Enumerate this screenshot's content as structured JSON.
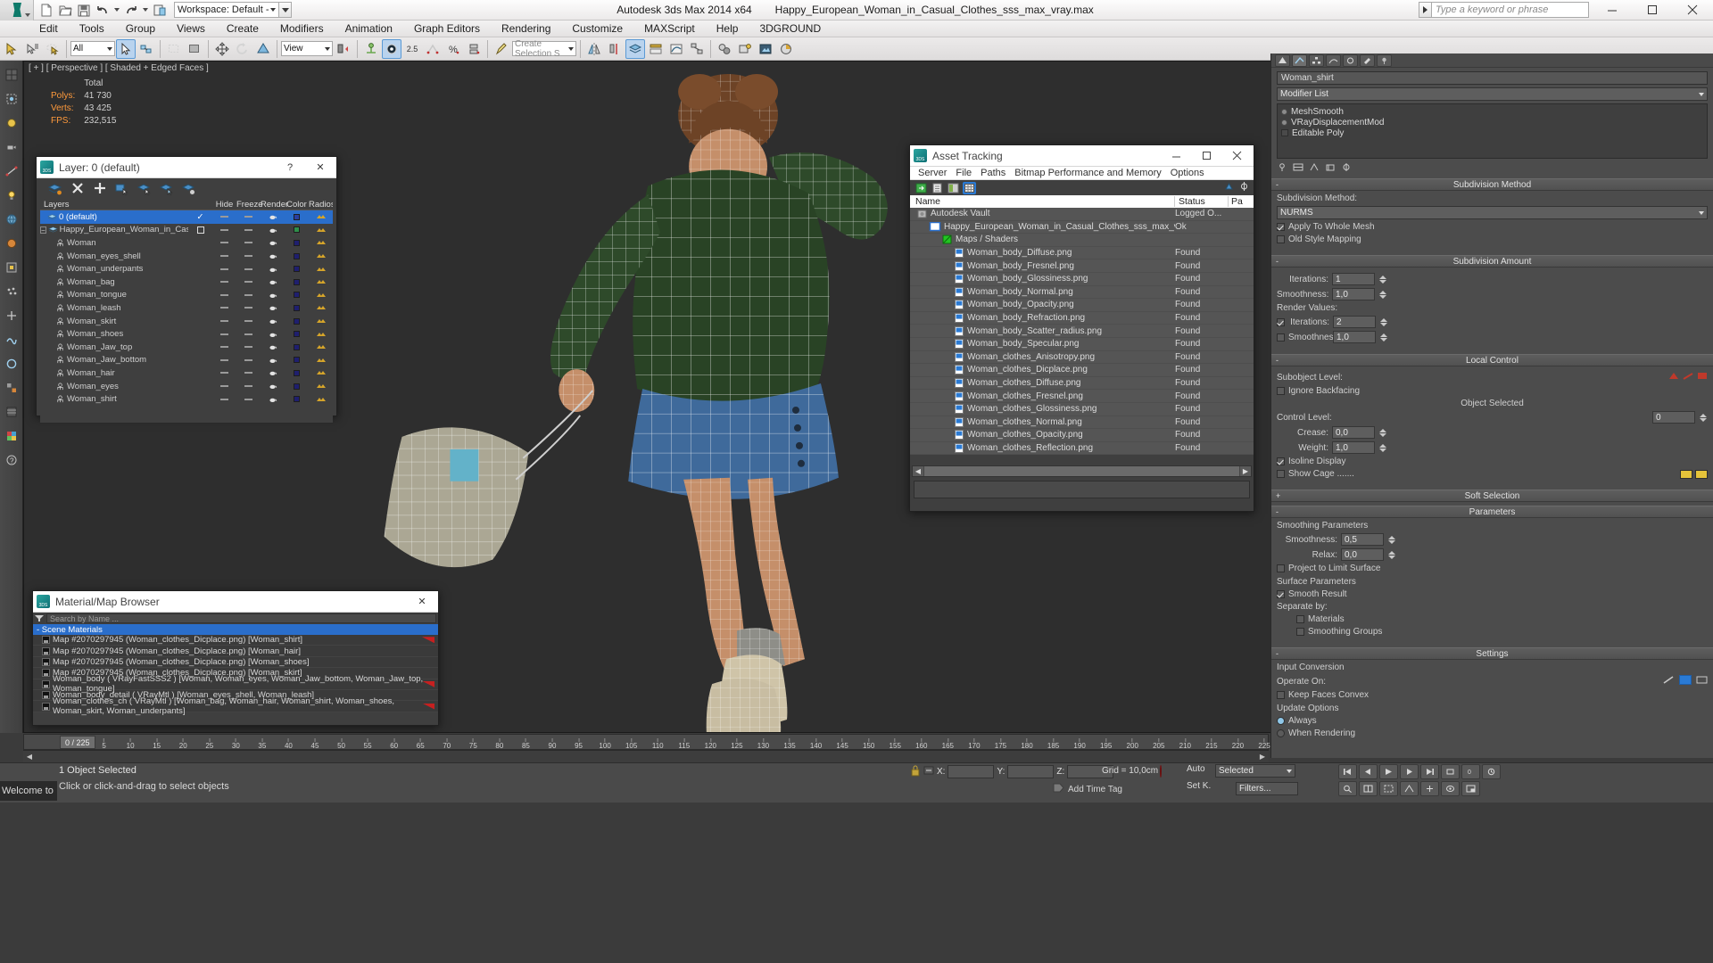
{
  "titlebar": {
    "workspace_label": "Workspace: Default - ",
    "app_title": "Autodesk 3ds Max  2014 x64",
    "file_title": "Happy_European_Woman_in_Casual_Clothes_sss_max_vray.max",
    "search_placeholder": "Type a keyword or phrase",
    "minimize": "–",
    "maximize": "☐",
    "close": "✕"
  },
  "menubar": {
    "items": [
      "Edit",
      "Tools",
      "Group",
      "Views",
      "Create",
      "Modifiers",
      "Animation",
      "Graph Editors",
      "Rendering",
      "Customize",
      "MAXScript",
      "Help",
      "3DGROUND"
    ]
  },
  "toolbar": {
    "filter_combo": "All",
    "ref_coord_combo": "View",
    "named_selection_placeholder": "Create Selection S",
    "percent_snap": "2.5"
  },
  "viewport": {
    "label": "[ + ] [ Perspective ] [ Shaded + Edged Faces ]",
    "stats": {
      "header": "Total",
      "rows": [
        {
          "label": "Polys:",
          "value": "41 730"
        },
        {
          "label": "Verts:",
          "value": "43 425"
        },
        {
          "label": "FPS:",
          "value": "232,515"
        }
      ]
    }
  },
  "layer_window": {
    "title": "Layer: 0 (default)",
    "help_btn": "?",
    "close_btn": "✕",
    "columns": [
      "Layers",
      "Hide",
      "Freeze",
      "Render",
      "Color",
      "Radiosity"
    ],
    "rows": [
      {
        "name": "0 (default)",
        "indent": 1,
        "selected": true,
        "active": true,
        "type": "layer"
      },
      {
        "name": "Happy_European_Woman_in_Casual_Clothes_sss",
        "indent": 0,
        "selected": false,
        "active": false,
        "type": "layer",
        "expander": "−"
      },
      {
        "name": "Woman",
        "indent": 2,
        "type": "object"
      },
      {
        "name": "Woman_eyes_shell",
        "indent": 2,
        "type": "object"
      },
      {
        "name": "Woman_underpants",
        "indent": 2,
        "type": "object"
      },
      {
        "name": "Woman_bag",
        "indent": 2,
        "type": "object"
      },
      {
        "name": "Woman_tongue",
        "indent": 2,
        "type": "object"
      },
      {
        "name": "Woman_leash",
        "indent": 2,
        "type": "object"
      },
      {
        "name": "Woman_skirt",
        "indent": 2,
        "type": "object"
      },
      {
        "name": "Woman_shoes",
        "indent": 2,
        "type": "object"
      },
      {
        "name": "Woman_Jaw_top",
        "indent": 2,
        "type": "object"
      },
      {
        "name": "Woman_Jaw_bottom",
        "indent": 2,
        "type": "object"
      },
      {
        "name": "Woman_hair",
        "indent": 2,
        "type": "object"
      },
      {
        "name": "Woman_eyes",
        "indent": 2,
        "type": "object"
      },
      {
        "name": "Woman_shirt",
        "indent": 2,
        "type": "object"
      }
    ]
  },
  "asset_window": {
    "title": "Asset Tracking",
    "minimize": "–",
    "maximize": "☐",
    "close": "✕",
    "menu": [
      "Server",
      "File",
      "Paths",
      "Bitmap Performance and Memory",
      "Options"
    ],
    "columns": {
      "name": "Name",
      "status": "Status",
      "path": "Pa"
    },
    "rows": [
      {
        "name": "Autodesk Vault",
        "status": "Logged O...",
        "indent": 0,
        "icon": "vault-icon"
      },
      {
        "name": "Happy_European_Woman_in_Casual_Clothes_sss_max_vray.max",
        "status": "Ok",
        "indent": 1,
        "icon": "scene-icon"
      },
      {
        "name": "Maps / Shaders",
        "status": "",
        "indent": 2,
        "icon": "maps-icon"
      },
      {
        "name": "Woman_body_Diffuse.png",
        "status": "Found",
        "indent": 3,
        "icon": "bitmap-icon"
      },
      {
        "name": "Woman_body_Fresnel.png",
        "status": "Found",
        "indent": 3,
        "icon": "bitmap-icon"
      },
      {
        "name": "Woman_body_Glossiness.png",
        "status": "Found",
        "indent": 3,
        "icon": "bitmap-icon"
      },
      {
        "name": "Woman_body_Normal.png",
        "status": "Found",
        "indent": 3,
        "icon": "bitmap-icon"
      },
      {
        "name": "Woman_body_Opacity.png",
        "status": "Found",
        "indent": 3,
        "icon": "bitmap-icon"
      },
      {
        "name": "Woman_body_Refraction.png",
        "status": "Found",
        "indent": 3,
        "icon": "bitmap-icon"
      },
      {
        "name": "Woman_body_Scatter_radius.png",
        "status": "Found",
        "indent": 3,
        "icon": "bitmap-icon"
      },
      {
        "name": "Woman_body_Specular.png",
        "status": "Found",
        "indent": 3,
        "icon": "bitmap-icon"
      },
      {
        "name": "Woman_clothes_Anisotropy.png",
        "status": "Found",
        "indent": 3,
        "icon": "bitmap-icon"
      },
      {
        "name": "Woman_clothes_Dicplace.png",
        "status": "Found",
        "indent": 3,
        "icon": "bitmap-icon"
      },
      {
        "name": "Woman_clothes_Diffuse.png",
        "status": "Found",
        "indent": 3,
        "icon": "bitmap-icon"
      },
      {
        "name": "Woman_clothes_Fresnel.png",
        "status": "Found",
        "indent": 3,
        "icon": "bitmap-icon"
      },
      {
        "name": "Woman_clothes_Glossiness.png",
        "status": "Found",
        "indent": 3,
        "icon": "bitmap-icon"
      },
      {
        "name": "Woman_clothes_Normal.png",
        "status": "Found",
        "indent": 3,
        "icon": "bitmap-icon"
      },
      {
        "name": "Woman_clothes_Opacity.png",
        "status": "Found",
        "indent": 3,
        "icon": "bitmap-icon"
      },
      {
        "name": "Woman_clothes_Reflection.png",
        "status": "Found",
        "indent": 3,
        "icon": "bitmap-icon"
      }
    ]
  },
  "material_window": {
    "title": "Material/Map Browser",
    "close_btn": "✕",
    "search_placeholder": "Search by Name ...",
    "group_header": "-  Scene Materials",
    "rows": [
      {
        "name": "Map #2070297945 (Woman_clothes_Dicplace.png)  [Woman_shirt]",
        "flag": true
      },
      {
        "name": "Map #2070297945 (Woman_clothes_Dicplace.png)  [Woman_hair]",
        "flag": false
      },
      {
        "name": "Map #2070297945 (Woman_clothes_Dicplace.png)  [Woman_shoes]",
        "flag": false
      },
      {
        "name": "Map #2070297945 (Woman_clothes_Dicplace.png)  [Woman_skirt]",
        "flag": false
      },
      {
        "name": "Woman_body  ( VRayFastSSS2 )  [Woman, Woman_eyes, Woman_Jaw_bottom, Woman_Jaw_top, Woman_tongue]",
        "flag": true
      },
      {
        "name": "Woman_body_detail  ( VRayMtl )  [Woman_eyes_shell, Woman_leash]",
        "flag": false
      },
      {
        "name": "Woman_clothes_ch  ( VRayMtl )  [Woman_bag, Woman_hair, Woman_shirt, Woman_shoes, Woman_skirt, Woman_underpants]",
        "flag": true
      }
    ]
  },
  "command_panel": {
    "object_name": "Woman_shirt",
    "modifier_list_label": "Modifier List",
    "modifier_stack": [
      "MeshSmooth",
      "VRayDisplacementMod",
      "Editable Poly"
    ],
    "rollouts": [
      {
        "title": "Subdivision Method",
        "method_label": "Subdivision Method:",
        "method_value": "NURMS",
        "apply_to_whole_mesh": "Apply To Whole Mesh",
        "old_style_mapping": "Old Style Mapping"
      },
      {
        "title": "Subdivision Amount",
        "iterations_label": "Iterations:",
        "iterations_value": "1",
        "smoothness_label": "Smoothness:",
        "smoothness_value": "1,0",
        "render_values_label": "Render Values:",
        "render_iterations_label": "Iterations:",
        "render_iterations_value": "2",
        "render_smoothness_label": "Smoothness:",
        "render_smoothness_value": "1,0"
      },
      {
        "title": "Local Control",
        "subobject_level_label": "Subobject Level:",
        "ignore_backfacing": "Ignore Backfacing",
        "object_selected": "Object Selected",
        "control_level_label": "Control Level:",
        "control_level_value": "0",
        "crease_label": "Crease:",
        "crease_value": "0,0",
        "weight_label": "Weight:",
        "weight_value": "1,0",
        "isoline_display": "Isoline Display",
        "show_cage": "Show Cage ......."
      },
      {
        "title": "Soft Selection"
      },
      {
        "title": "Parameters",
        "smoothing_parameters_label": "Smoothing Parameters",
        "smoothness_label": "Smoothness:",
        "smoothness_value": "0,5",
        "relax_label": "Relax:",
        "relax_value": "0,0",
        "project_to_limit_surface": "Project to Limit Surface",
        "surface_parameters_label": "Surface Parameters",
        "smooth_result": "Smooth Result",
        "separate_by_label": "Separate by:",
        "materials": "Materials",
        "smoothing_groups": "Smoothing Groups"
      },
      {
        "title": "Settings",
        "input_conversion_label": "Input Conversion",
        "operate_on_label": "Operate On:",
        "keep_faces_convex": "Keep Faces Convex",
        "update_options_label": "Update Options",
        "always": "Always",
        "when_rendering": "When Rendering"
      }
    ]
  },
  "timeline": {
    "slider_label": "0 / 225",
    "ticks": [
      "0",
      "5",
      "10",
      "15",
      "20",
      "25",
      "30",
      "35",
      "40",
      "45",
      "50",
      "55",
      "60",
      "65",
      "70",
      "75",
      "80",
      "85",
      "90",
      "95",
      "100",
      "105",
      "110",
      "115",
      "120",
      "125",
      "130",
      "135",
      "140",
      "145",
      "150",
      "155",
      "160",
      "165",
      "170",
      "175",
      "180",
      "185",
      "190",
      "195",
      "200",
      "205",
      "210",
      "215",
      "220",
      "225"
    ]
  },
  "statusbar": {
    "welcome": "Welcome to",
    "selection_info": "1 Object Selected",
    "prompt": "Click or click-and-drag to select objects",
    "coord_labels": {
      "x": "X:",
      "y": "Y:",
      "z": "Z:"
    },
    "coord_values": {
      "x": "",
      "y": "",
      "z": ""
    },
    "grid": "Grid = 10,0cm",
    "add_time_tag": "Add Time Tag",
    "auto_key": "Auto",
    "set_key": "Set K.",
    "selection_filter": "Selected",
    "filters": "Filters..."
  }
}
